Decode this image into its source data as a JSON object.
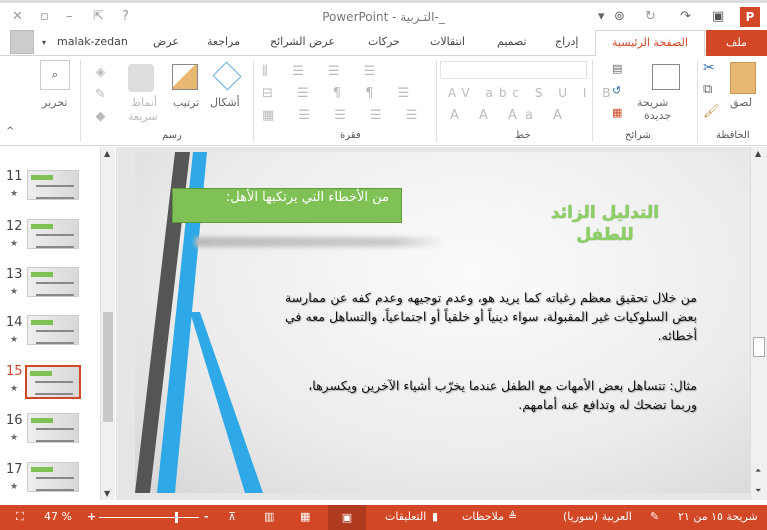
{
  "window": {
    "title": "PowerPoint - التـربية-_"
  },
  "tabs": {
    "file": "ملف",
    "home": "الصفحة الرئيسية",
    "insert": "إدراج",
    "design": "تصميم",
    "transitions": "انتقالات",
    "animations": "حركات",
    "slideshow": "عرض الشرائح",
    "review": "مراجعة",
    "view": "عرض",
    "user": "malak-zedan"
  },
  "ribbon": {
    "clipboard": {
      "label": "الحافظة",
      "paste": "لصق"
    },
    "slides": {
      "label": "شرائح",
      "new_slide": "شريحة",
      "new_slide2": "جديدة"
    },
    "font": {
      "label": "خط"
    },
    "paragraph": {
      "label": "فقرة"
    },
    "drawing": {
      "label": "رسم",
      "shapes": "أشكال",
      "arrange": "ترتيب",
      "styles": "أنماط",
      "styles2": "سريعة"
    },
    "editing": {
      "label": "تحرير"
    }
  },
  "thumbnails": [
    {
      "num": "11"
    },
    {
      "num": "12"
    },
    {
      "num": "13"
    },
    {
      "num": "14"
    },
    {
      "num": "15",
      "selected": true
    },
    {
      "num": "16"
    },
    {
      "num": "17"
    }
  ],
  "slide": {
    "box_text": "من الأخطاء التي يرتكبها الأهل:",
    "title_line1": "التدليل الزائد",
    "title_line2": "للطفل",
    "para1": "من خلال تحقيق معظم رغباته كما يريد هو، وعدم توجيهه وعدم كفه عن ممارسة بعض السلوكيات غير المقبولة، سواء دينياً أو خلقياً أو اجتماعياً، والتساهل معه في أخطائه.",
    "para2": "مثال: تتساهل بعض الأمهات مع الطفل عندما يخرّب أشياء الآخرين ويكسرها، وربما تضحك له وتدافع عنه أمامهم."
  },
  "status": {
    "slide_info": "شريحة ١٥ من ٢١",
    "language": "العربية (سوريا)",
    "notes": "ملاحظات",
    "comments": "التعليقات",
    "zoom": "47 %",
    "zoom_fraction": 0.47
  },
  "colors": {
    "accent": "#d24726",
    "green_box": "#7fc155"
  }
}
